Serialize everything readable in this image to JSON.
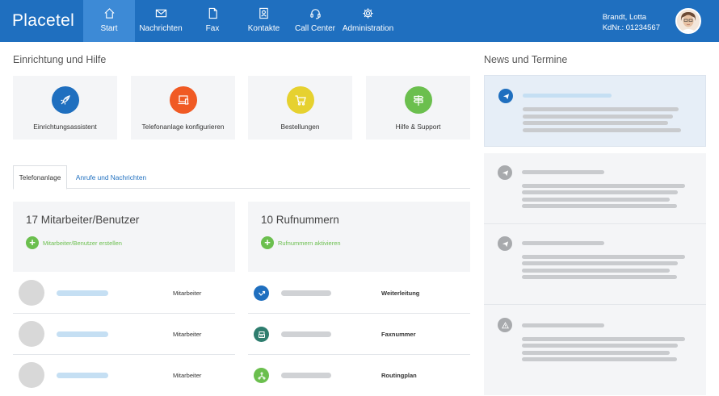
{
  "app": {
    "logo": "Placetel"
  },
  "nav": [
    {
      "label": "Start",
      "icon": "home-icon",
      "active": true
    },
    {
      "label": "Nachrichten",
      "icon": "mail-icon"
    },
    {
      "label": "Fax",
      "icon": "fax-document-icon"
    },
    {
      "label": "Kontakte",
      "icon": "contacts-book-icon"
    },
    {
      "label": "Call Center",
      "icon": "headset-icon"
    },
    {
      "label": "Administration",
      "icon": "gear-icon"
    }
  ],
  "user": {
    "name": "Brandt, Lotta",
    "customer_no": "KdNr.: 01234567"
  },
  "setup": {
    "title": "Einrichtung und Hilfe",
    "cards": [
      {
        "label": "Einrichtungsassistent",
        "icon": "rocket-icon",
        "color": "#1f6fbf"
      },
      {
        "label": "Telefonanlage konfigurieren",
        "icon": "computer-phone-icon",
        "color": "#f05a24"
      },
      {
        "label": "Bestellungen",
        "icon": "shopping-cart-icon",
        "color": "#e6d12f"
      },
      {
        "label": "Hilfe & Support",
        "icon": "signpost-icon",
        "color": "#6bbf4e"
      }
    ]
  },
  "tabs": [
    {
      "label": "Telefonanlage",
      "active": true
    },
    {
      "label": "Anrufe und Nachrichten",
      "active": false
    }
  ],
  "employees": {
    "title": "17 Mitarbeiter/Benutzer",
    "action": "Mitarbeiter/Benutzer erstellen",
    "rows": [
      {
        "role": "Mitarbeiter"
      },
      {
        "role": "Mitarbeiter"
      },
      {
        "role": "Mitarbeiter"
      }
    ]
  },
  "numbers": {
    "title": "10 Rufnummern",
    "action": "Rufnummern aktivieren",
    "rows": [
      {
        "type": "Weiterleitung",
        "icon": "forward-arrow-icon",
        "color": "#1f6fbf"
      },
      {
        "type": "Faxnummer",
        "icon": "fax-icon",
        "color": "#2e7d6e"
      },
      {
        "type": "Routingplan",
        "icon": "routing-icon",
        "color": "#6bbf4e"
      }
    ]
  },
  "news": {
    "title": "News und Termine",
    "items": [
      {
        "icon": "paper-plane-icon",
        "highlighted": true,
        "color": "#1f6fbf"
      },
      {
        "icon": "paper-plane-icon",
        "highlighted": false,
        "color": "#a8aaad"
      },
      {
        "icon": "paper-plane-icon",
        "highlighted": false,
        "color": "#a8aaad"
      },
      {
        "icon": "warning-icon",
        "highlighted": false,
        "color": "#a8aaad"
      }
    ]
  },
  "colors": {
    "brand": "#1f6fbf",
    "nav_active": "#3d8ad6",
    "success": "#6bbf4e"
  }
}
